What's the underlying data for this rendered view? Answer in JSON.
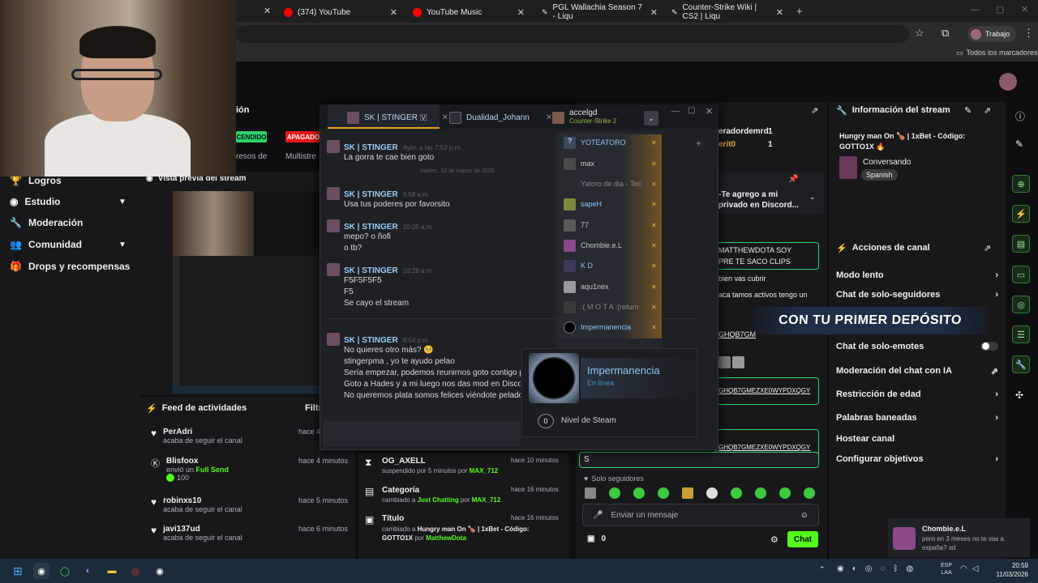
{
  "browser": {
    "tabs": [
      {
        "title": "(374) YouTube",
        "color": "#ff0000"
      },
      {
        "title": "YouTube Music",
        "color": "#ff0000"
      },
      {
        "title": "PGL Wallachia Season 7 - Liqu",
        "color": "#ffffff"
      },
      {
        "title": "Counter-Strike Wiki | CS2 | Liqu",
        "color": "#ffffff"
      }
    ],
    "profile_label": "Trabajo",
    "bookmarks_label": "Todos los marcadores"
  },
  "twitch_top": {
    "section_label": "ión",
    "badge_on": "CENDIDO",
    "badge_off": "APAGADO",
    "cut_label_1": "resos de",
    "cut_label_2": "Multistre"
  },
  "left_nav": {
    "items": [
      {
        "label": "Logros",
        "icon": "trophy-icon"
      },
      {
        "label": "Estudio",
        "icon": "camera-icon"
      },
      {
        "label": "Moderación",
        "icon": "wrench-icon"
      },
      {
        "label": "Comunidad",
        "icon": "users-icon"
      },
      {
        "label": "Drops y recompensas",
        "icon": "gift-icon"
      }
    ]
  },
  "preview": {
    "title": "Vista previa del stream"
  },
  "activity": {
    "title": "Feed de actividades",
    "filter_label": "Filtr",
    "items": [
      {
        "name": "PerAdri",
        "sub": "acaba de seguir el canal",
        "time": "hace 4",
        "icon": "heart-icon"
      },
      {
        "name": "Blisfoox",
        "sub": "envió un",
        "sub_accent": "Full Send",
        "points": "100",
        "time": "hace 4 minutos",
        "icon": "kick-icon"
      },
      {
        "name": "robinxs10",
        "sub": "acaba de seguir el canal",
        "time": "hace 5 minutos",
        "icon": "heart-icon"
      },
      {
        "name": "javi137ud",
        "sub": "acaba de seguir el canal",
        "time": "hace 6 minutos",
        "icon": "heart-icon"
      }
    ]
  },
  "modlog": {
    "items": [
      {
        "name": "OG_AXELL",
        "sub": "suspendido por 5 minutos por",
        "by": "MAX_712",
        "time": "hace 10 minutos",
        "icon": "hourglass-icon"
      },
      {
        "name": "Categoría",
        "sub": "cambiado a",
        "accent": "Just Chatting",
        "sub2": "por",
        "by": "MAX_712",
        "time": "hace 16 minutos",
        "icon": "category-icon"
      },
      {
        "name": "Título",
        "sub": "cambiado a",
        "accent": "Hungry man On 🍗 | 1xBet - Código: GOTTO1X",
        "sub2": "por",
        "by": "MatthewDota",
        "time": "hace 16 minutos",
        "icon": "title-icon"
      }
    ]
  },
  "steam": {
    "tabs": [
      {
        "name": "SK | STINGER 🇻"
      },
      {
        "name": "Dualidad_Johann"
      },
      {
        "name": "accelgd",
        "game": "Counter-Strike 2"
      }
    ],
    "messages": [
      {
        "name": "SK | STINGER",
        "time": "Ayer, a las 7:53 p.m.",
        "lines": [
          "La gorra te cae bien goto"
        ]
      },
      {
        "divider": "martes, 10 de marzo de 2026"
      },
      {
        "name": "SK | STINGER",
        "time": "9:58 a.m.",
        "lines": [
          "Usa tus poderes por favorsito"
        ]
      },
      {
        "name": "SK | STINGER",
        "time": "10:05 a.m.",
        "lines": [
          "mepo? o ñofi",
          "o tb?"
        ]
      },
      {
        "name": "SK | STINGER",
        "time": "10:29 a.m.",
        "lines": [
          "F5F5F5F5",
          "F5",
          "Se cayo el stream"
        ]
      },
      {
        "name": "SK | STINGER",
        "time": "8:54 p.m.",
        "lines": [
          "No quieres otro más? 🥺",
          "stingerpma , yo te ayudo pelao",
          "Sería empezar, podemos reunirnos goto contigo pa",
          "Goto a Hades y a mi luego nos das mod en Discord",
          "No queremos plata somos felices viéndote pelado"
        ]
      }
    ],
    "friends": [
      {
        "name": "YOTEATORO",
        "color": "#3b4a5c",
        "highlight": true
      },
      {
        "name": "max",
        "color": "#4a4a4a"
      },
      {
        "name": "Yatoro de dia - Tec",
        "color": "#2a2a2a",
        "dim": true
      },
      {
        "name": "sapeH",
        "color": "#7a8a3a",
        "highlight": true
      },
      {
        "name": "77",
        "color": "#5a5a5a"
      },
      {
        "name": "Chombie.e.L",
        "color": "#8a4a8a"
      },
      {
        "name": "K D",
        "color": "#3a3a5a",
        "highlight": true
      },
      {
        "name": "aqu1nex",
        "color": "#9a9a9a"
      },
      {
        "name": ":( M O T A :(return",
        "color": "#3a3a3a",
        "dim": true
      },
      {
        "name": "Impermanencia",
        "color": "#000000",
        "highlight": true
      }
    ],
    "popup": {
      "name": "Impermanencia",
      "status": "En línea",
      "level": "0",
      "level_label": "Nivel de Steam"
    }
  },
  "twitch_chat": {
    "lines": [
      {
        "text": "eradordemrd",
        "count": "1"
      },
      {
        "text": "erit0",
        "count": "1"
      }
    ],
    "pinned": "-Te agrego a mi privado en Discord...",
    "msgs": [
      "MATTHEWDOTA SOY",
      "PRE TE SACO CLIPS",
      "bien vas cubrir",
      "aca tamos activos tengo un",
      "GHQB7GM",
      "GHQB7GMEZXE0WYPDXQGY",
      "GHQB7GMEZXE0WYPDXQGY"
    ],
    "input_value": "S",
    "followers_only": "Solo seguidores",
    "send_placeholder": "Enviar un mensaje",
    "points": "0",
    "chat_button": "Chat",
    "overlay_banner": "CON TU PRIMER DEPÓSITO"
  },
  "stream_info": {
    "title": "Información del stream",
    "stream_title": "Hungry man On 🍗 | 1xBet - Código: GOTTO1X 🔥",
    "category": "Conversando",
    "language": "Spanish"
  },
  "channel_actions": {
    "title": "Acciones de canal",
    "items": [
      {
        "label": "Modo lento",
        "type": "chevron"
      },
      {
        "label": "Chat de solo-seguidores",
        "type": "chevron"
      },
      {
        "label": "Chat de solo-emotes",
        "type": "toggle"
      },
      {
        "label": "Moderación del chat con IA",
        "type": "external"
      },
      {
        "label": "Restricción de edad",
        "type": "chevron"
      },
      {
        "label": "Palabras baneadas",
        "type": "chevron"
      },
      {
        "label": "Hostear canal",
        "type": "none"
      },
      {
        "label": "Configurar objetivos",
        "type": "chevron"
      }
    ]
  },
  "notification": {
    "name": "Chombie.e.L",
    "text": "pero en 3 meses no te vas a españa? xd"
  },
  "taskbar": {
    "lang": "ESP",
    "lang2": "LAA",
    "time": "20:59",
    "date": "11/03/2026"
  }
}
